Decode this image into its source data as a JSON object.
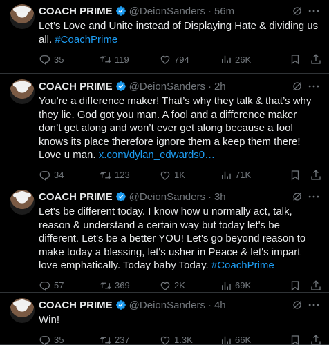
{
  "tweets": [
    {
      "name": "COACH PRIME",
      "handle": "@DeionSanders",
      "sep": "·",
      "time": "56m",
      "text": "Let’s Love and Unite instead of Displaying Hate & dividing us all. ",
      "hashtag": "#CoachPrime",
      "link": "",
      "replies": "35",
      "retweets": "119",
      "likes": "794",
      "views": "26K"
    },
    {
      "name": "COACH PRIME",
      "handle": "@DeionSanders",
      "sep": "·",
      "time": "2h",
      "text": "You’re a difference maker! That’s why they talk & that’s why they lie. God got you man. A fool and a difference maker don’t get along and won’t ever get along because a fool knows its place therefore ignore them a keep them there! Love u man. ",
      "hashtag": "",
      "link": "x.com/dylan_edwards0…",
      "replies": "34",
      "retweets": "123",
      "likes": "1K",
      "views": "71K"
    },
    {
      "name": "COACH PRIME",
      "handle": "@DeionSanders",
      "sep": "·",
      "time": "3h",
      "text": "Let's be different today. I know how u normally act, talk, reason & understand a certain way but today let's be different. Let's be a better YOU! Let's go beyond reason to make today a blessing, let's usher in Peace & let's impart love emphatically. Today baby Today. ",
      "hashtag": "#CoachPrime",
      "link": "",
      "replies": "57",
      "retweets": "369",
      "likes": "2K",
      "views": "69K"
    },
    {
      "name": "COACH PRIME",
      "handle": "@DeionSanders",
      "sep": "·",
      "time": "4h",
      "text": "Win!",
      "hashtag": "",
      "link": "",
      "replies": "35",
      "retweets": "237",
      "likes": "1.3K",
      "views": "66K"
    }
  ],
  "colors": {
    "background": "#000000",
    "text": "#e7e9ea",
    "muted": "#71767b",
    "accent": "#1d9bf0",
    "divider": "#2f3336"
  },
  "icons": [
    "avatar",
    "verified-badge-icon",
    "grok-icon",
    "more-icon",
    "reply-icon",
    "retweet-icon",
    "like-icon",
    "views-icon",
    "bookmark-icon",
    "share-icon"
  ]
}
